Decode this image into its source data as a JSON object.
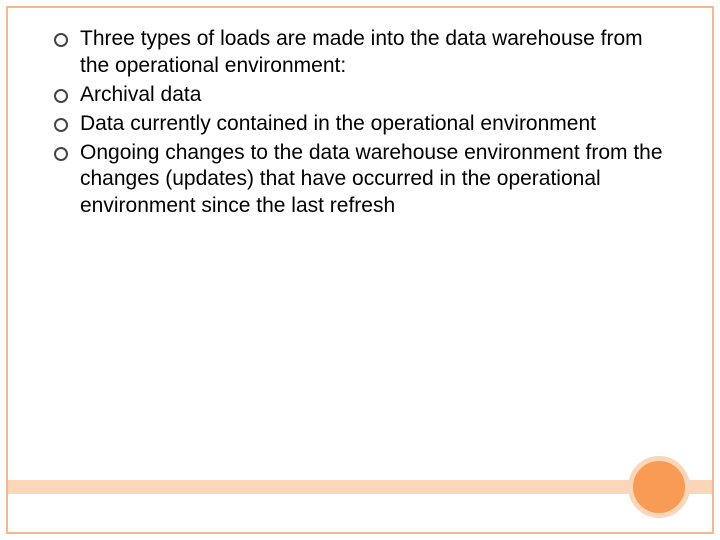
{
  "slide": {
    "bullets": [
      "Three types of loads are made into the data warehouse from the operational environment:",
      "Archival data",
      " Data currently contained in the operational environment",
      "Ongoing changes to the data warehouse environment from the changes (updates) that have occurred in the operational environment since the last refresh"
    ]
  },
  "theme": {
    "border_color": "#f6b98e",
    "accent_fill": "#f89b54",
    "accent_light": "#fcd6b8"
  }
}
